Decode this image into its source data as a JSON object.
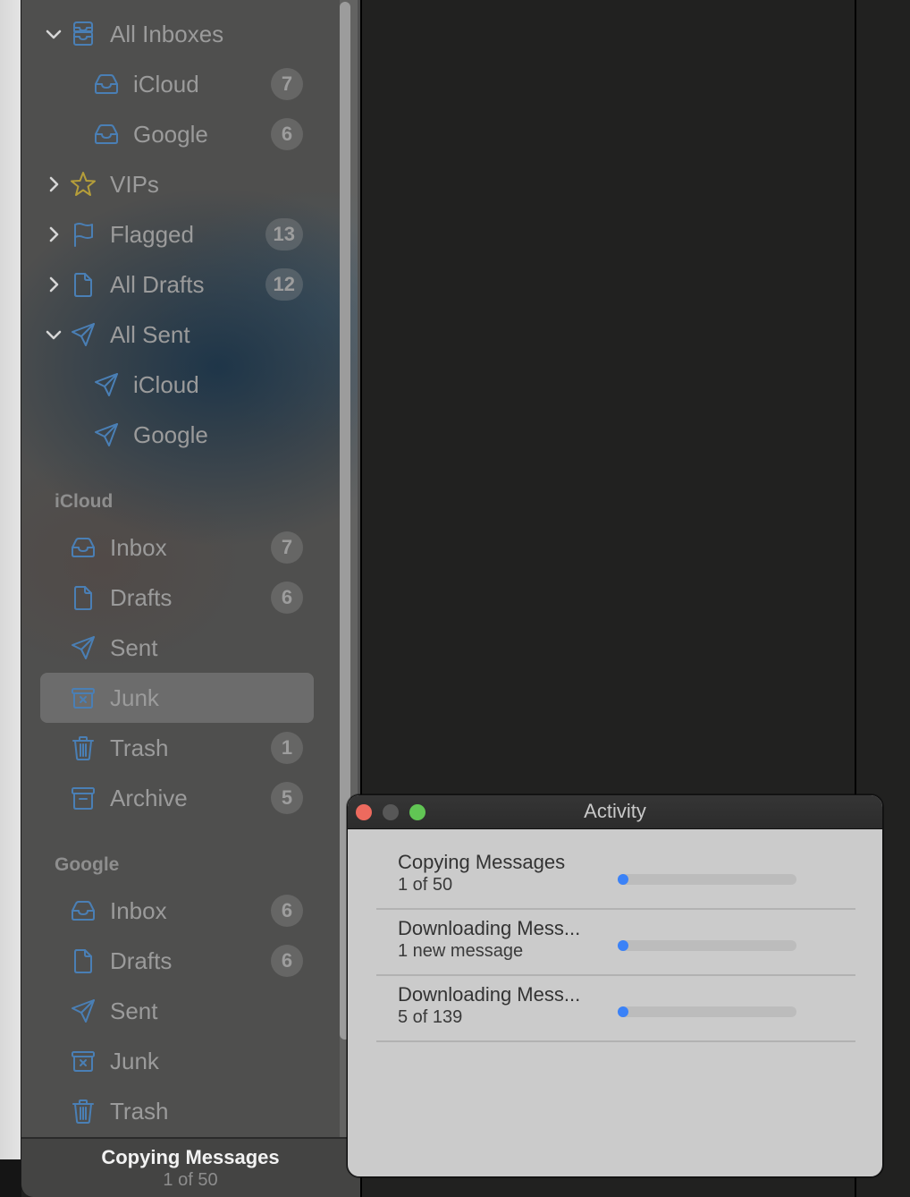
{
  "sidebar": {
    "favorites": [
      {
        "label": "All Inboxes",
        "icon": "tray-stack-icon",
        "chevron": "down",
        "level": 0,
        "badge": null
      },
      {
        "label": "iCloud",
        "icon": "tray-icon",
        "chevron": null,
        "level": 1,
        "badge": "7"
      },
      {
        "label": "Google",
        "icon": "tray-icon",
        "chevron": null,
        "level": 1,
        "badge": "6"
      },
      {
        "label": "VIPs",
        "icon": "star-icon",
        "chevron": "right",
        "level": 0,
        "badge": null
      },
      {
        "label": "Flagged",
        "icon": "flag-icon",
        "chevron": "right",
        "level": 0,
        "badge": "13"
      },
      {
        "label": "All Drafts",
        "icon": "document-icon",
        "chevron": "right",
        "level": 0,
        "badge": "12"
      },
      {
        "label": "All Sent",
        "icon": "paperplane-icon",
        "chevron": "down",
        "level": 0,
        "badge": null
      },
      {
        "label": "iCloud",
        "icon": "paperplane-icon",
        "chevron": null,
        "level": 1,
        "badge": null
      },
      {
        "label": "Google",
        "icon": "paperplane-icon",
        "chevron": null,
        "level": 1,
        "badge": null
      }
    ],
    "accounts": [
      {
        "name": "iCloud",
        "items": [
          {
            "label": "Inbox",
            "icon": "tray-icon",
            "badge": "7",
            "selected": false
          },
          {
            "label": "Drafts",
            "icon": "document-icon",
            "badge": "6",
            "selected": false
          },
          {
            "label": "Sent",
            "icon": "paperplane-icon",
            "badge": null,
            "selected": false
          },
          {
            "label": "Junk",
            "icon": "junk-bin-icon",
            "badge": null,
            "selected": true
          },
          {
            "label": "Trash",
            "icon": "trash-icon",
            "badge": "1",
            "selected": false
          },
          {
            "label": "Archive",
            "icon": "archive-box-icon",
            "badge": "5",
            "selected": false
          }
        ]
      },
      {
        "name": "Google",
        "items": [
          {
            "label": "Inbox",
            "icon": "tray-icon",
            "badge": "6",
            "selected": false
          },
          {
            "label": "Drafts",
            "icon": "document-icon",
            "badge": "6",
            "selected": false
          },
          {
            "label": "Sent",
            "icon": "paperplane-icon",
            "badge": null,
            "selected": false
          },
          {
            "label": "Junk",
            "icon": "junk-bin-icon",
            "badge": null,
            "selected": false
          },
          {
            "label": "Trash",
            "icon": "trash-icon",
            "badge": null,
            "selected": false
          }
        ]
      }
    ],
    "footer": {
      "title": "Copying Messages",
      "subtitle": "1 of 50"
    }
  },
  "activity_window": {
    "title": "Activity",
    "tasks": [
      {
        "name": "Copying Messages",
        "detail": "1 of 50",
        "progress": 0.02
      },
      {
        "name": "Downloading Mess...",
        "detail": "1 new message",
        "progress": 0.02
      },
      {
        "name": "Downloading Mess...",
        "detail": "5 of 139",
        "progress": 0.036
      }
    ]
  },
  "colors": {
    "icon_blue": "#4a7fb5",
    "star_yellow": "#b59e3a",
    "progress_blue": "#3b82f7",
    "close_red": "#ed6a5e",
    "minimize_disabled": "#575757",
    "zoom_green": "#61c554"
  }
}
